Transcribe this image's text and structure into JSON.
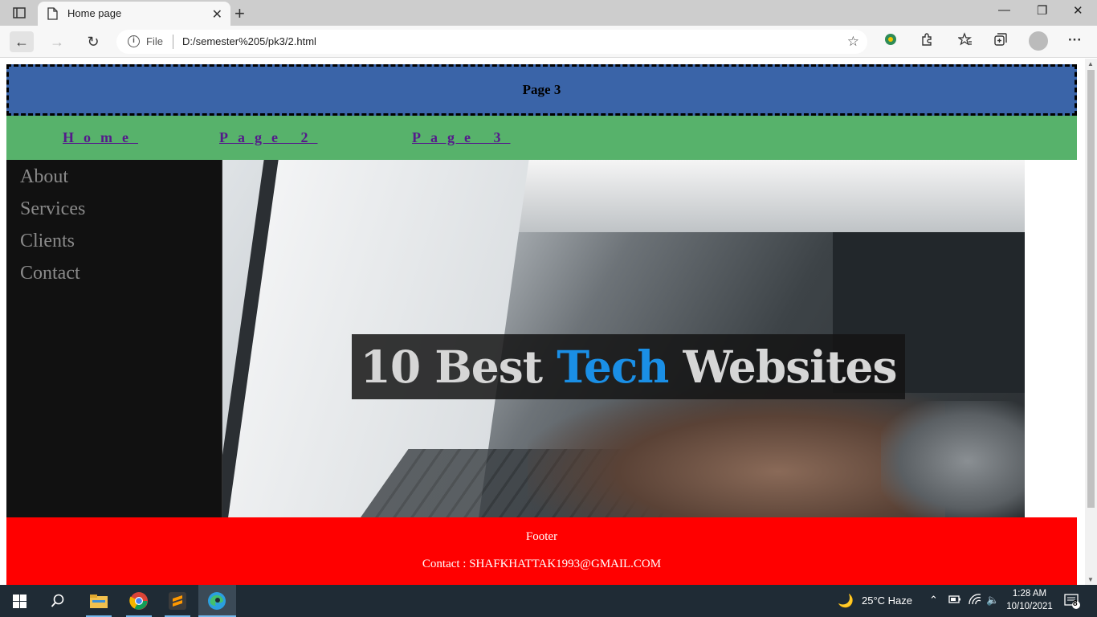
{
  "browser": {
    "tab_title": "Home page",
    "address_file_label": "File",
    "url": "D:/semester%205/pk3/2.html"
  },
  "page": {
    "header_title": "Page 3",
    "nav": [
      {
        "label": "Home"
      },
      {
        "label": "Page 2"
      },
      {
        "label": "Page 3"
      }
    ],
    "sidebar": [
      {
        "label": "About"
      },
      {
        "label": "Services"
      },
      {
        "label": "Clients"
      },
      {
        "label": "Contact"
      }
    ],
    "hero": {
      "part1": "10 Best ",
      "accent": "Tech",
      "part2": " Websites"
    },
    "footer": {
      "title": "Footer",
      "contact": "Contact : SHAFKHATTAK1993@GMAIL.COM"
    }
  },
  "taskbar": {
    "weather": "25°C  Haze",
    "time": "1:28 AM",
    "date": "10/10/2021",
    "notifications": "8"
  },
  "colors": {
    "header_bg": "#3a64a8",
    "nav_bg": "#57b26b",
    "sidebar_bg": "#111111",
    "footer_bg": "#ff0000",
    "link": "#551a8b",
    "accent": "#1a8fe6"
  }
}
